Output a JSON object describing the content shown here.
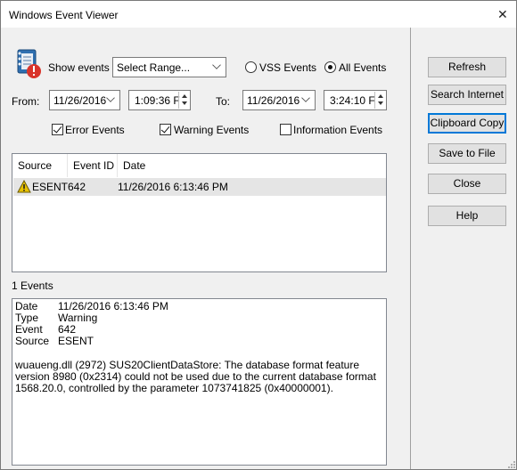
{
  "window": {
    "title": "Windows Event Viewer"
  },
  "filters": {
    "show_events_label": "Show events",
    "range_select_value": "Select Range...",
    "vss_events_label": "VSS Events",
    "all_events_label": "All Events",
    "from_label": "From:",
    "from_date": "11/26/2016",
    "from_time": "1:09:36 F",
    "to_label": "To:",
    "to_date": "11/26/2016",
    "to_time": "3:24:10 F",
    "error_events_label": "Error Events",
    "warning_events_label": "Warning Events",
    "information_events_label": "Information Events"
  },
  "table": {
    "columns": [
      "Source",
      "Event ID",
      "Date"
    ],
    "rows": [
      {
        "icon": "warning-icon",
        "source": "ESENT",
        "event_id": "642",
        "date": "11/26/2016 6:13:46 PM"
      }
    ]
  },
  "status": {
    "count": "1 Events"
  },
  "detail": {
    "date_key": "Date",
    "date_val": "11/26/2016 6:13:46 PM",
    "type_key": "Type",
    "type_val": "Warning",
    "event_key": "Event",
    "event_val": "642",
    "source_key": "Source",
    "source_val": "ESENT",
    "message": "wuaueng.dll (2972) SUS20ClientDataStore: The database format feature version 8980 (0x2314) could not be used due to the current database format 1568.20.0, controlled by the parameter 1073741825 (0x40000001)."
  },
  "buttons": {
    "refresh": "Refresh",
    "search_internet": "Search Internet",
    "clipboard_copy": "Clipboard Copy",
    "save_to_file": "Save to File",
    "close": "Close",
    "help": "Help"
  },
  "colors": {
    "accent": "#0078d7",
    "selected_row": "#e5e5e5",
    "warning": "#e8c200"
  }
}
